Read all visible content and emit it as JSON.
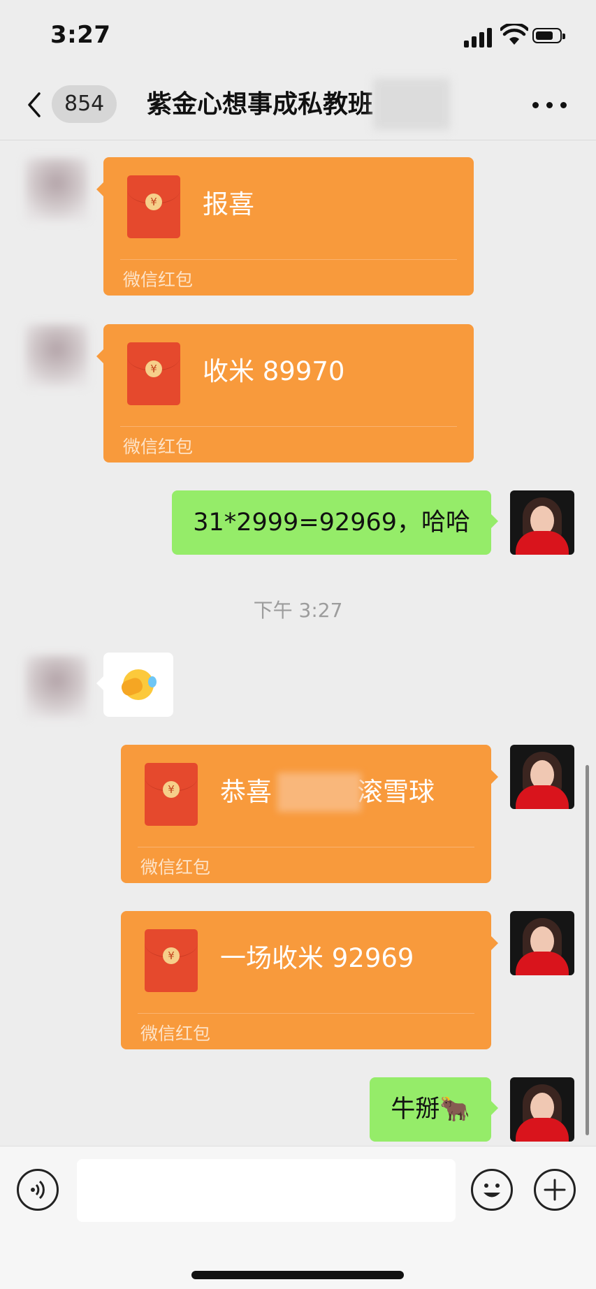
{
  "status_bar": {
    "time": "3:27"
  },
  "nav": {
    "unread_count": "854",
    "title": "紫金心想事成私教班"
  },
  "messages": {
    "m1": {
      "title": "报喜",
      "footer": "微信红包"
    },
    "m2": {
      "title": "收米 89970",
      "footer": "微信红包"
    },
    "m3": {
      "text": "31*2999=92969，哈哈"
    },
    "timestamp": "下午 3:27",
    "m5": {
      "title_prefix": "恭喜",
      "title_suffix": "滚雪球",
      "footer": "微信红包"
    },
    "m6": {
      "title": "一场收米 92969",
      "footer": "微信红包"
    },
    "m7": {
      "text": "牛掰🐂"
    }
  },
  "input_bar": {
    "value": "",
    "placeholder": ""
  },
  "colors": {
    "red_packet": "#f89a3c",
    "my_bubble": "#95ec69",
    "background": "#ededed"
  }
}
